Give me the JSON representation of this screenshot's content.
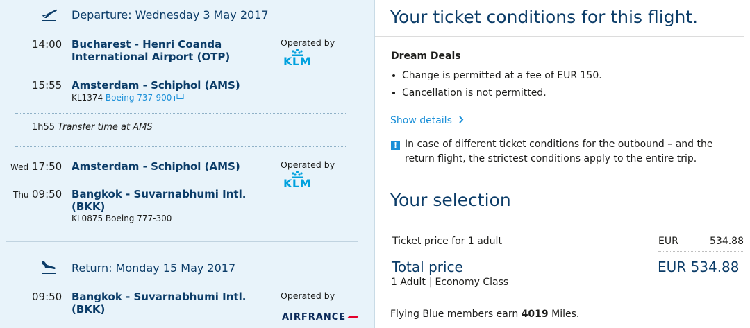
{
  "outbound": {
    "header": "Departure: Wednesday 3 May 2017",
    "leg1": {
      "dep_time": "14:00",
      "dep_airport": "Bucharest - Henri Coanda International Airport (OTP)",
      "arr_time": "15:55",
      "arr_airport": "Amsterdam - Schiphol (AMS)",
      "flight_no": "KL1374",
      "aircraft": "Boeing 737-900",
      "operated_by": "Operated by",
      "carrier": "KLM"
    },
    "transfer": {
      "duration": "1h55",
      "text": "Transfer time at AMS"
    },
    "leg2": {
      "dep_day": "Wed",
      "dep_time": "17:50",
      "dep_airport": "Amsterdam - Schiphol (AMS)",
      "arr_day": "Thu",
      "arr_time": "09:50",
      "arr_airport": "Bangkok - Suvarnabhumi Intl. (BKK)",
      "flight_info": "KL0875 Boeing 777-300",
      "operated_by": "Operated by",
      "carrier": "KLM"
    }
  },
  "return": {
    "header": "Return: Monday 15 May 2017",
    "leg1": {
      "dep_time": "09:50",
      "dep_airport": "Bangkok - Suvarnabhumi Intl. (BKK)",
      "operated_by": "Operated by",
      "carrier": "AIRFRANCE"
    }
  },
  "conditions": {
    "title": "Your ticket conditions for this flight.",
    "fare_name": "Dream Deals",
    "bullets": [
      "Change is permitted at a fee of EUR 150.",
      "Cancellation is not permitted."
    ],
    "show_details": "Show details",
    "note": "In case of different ticket conditions for the outbound – and the return flight, the strictest conditions apply to the entire trip."
  },
  "selection": {
    "title": "Your selection",
    "ticket_label": "Ticket price for 1 adult",
    "ticket_currency": "EUR",
    "ticket_amount": "534.88",
    "total_label": "Total price",
    "total_value": "EUR 534.88",
    "passengers": "1 Adult",
    "cabin": "Economy Class",
    "miles_prefix": "Flying Blue members earn",
    "miles_value": "4019",
    "miles_suffix": "Miles."
  },
  "colors": {
    "panel_bg": "#e8f3fa",
    "brand_navy": "#0b3c68",
    "link_blue": "#1a8fd8",
    "klm_blue": "#00a1de",
    "af_red": "#e4002b"
  }
}
